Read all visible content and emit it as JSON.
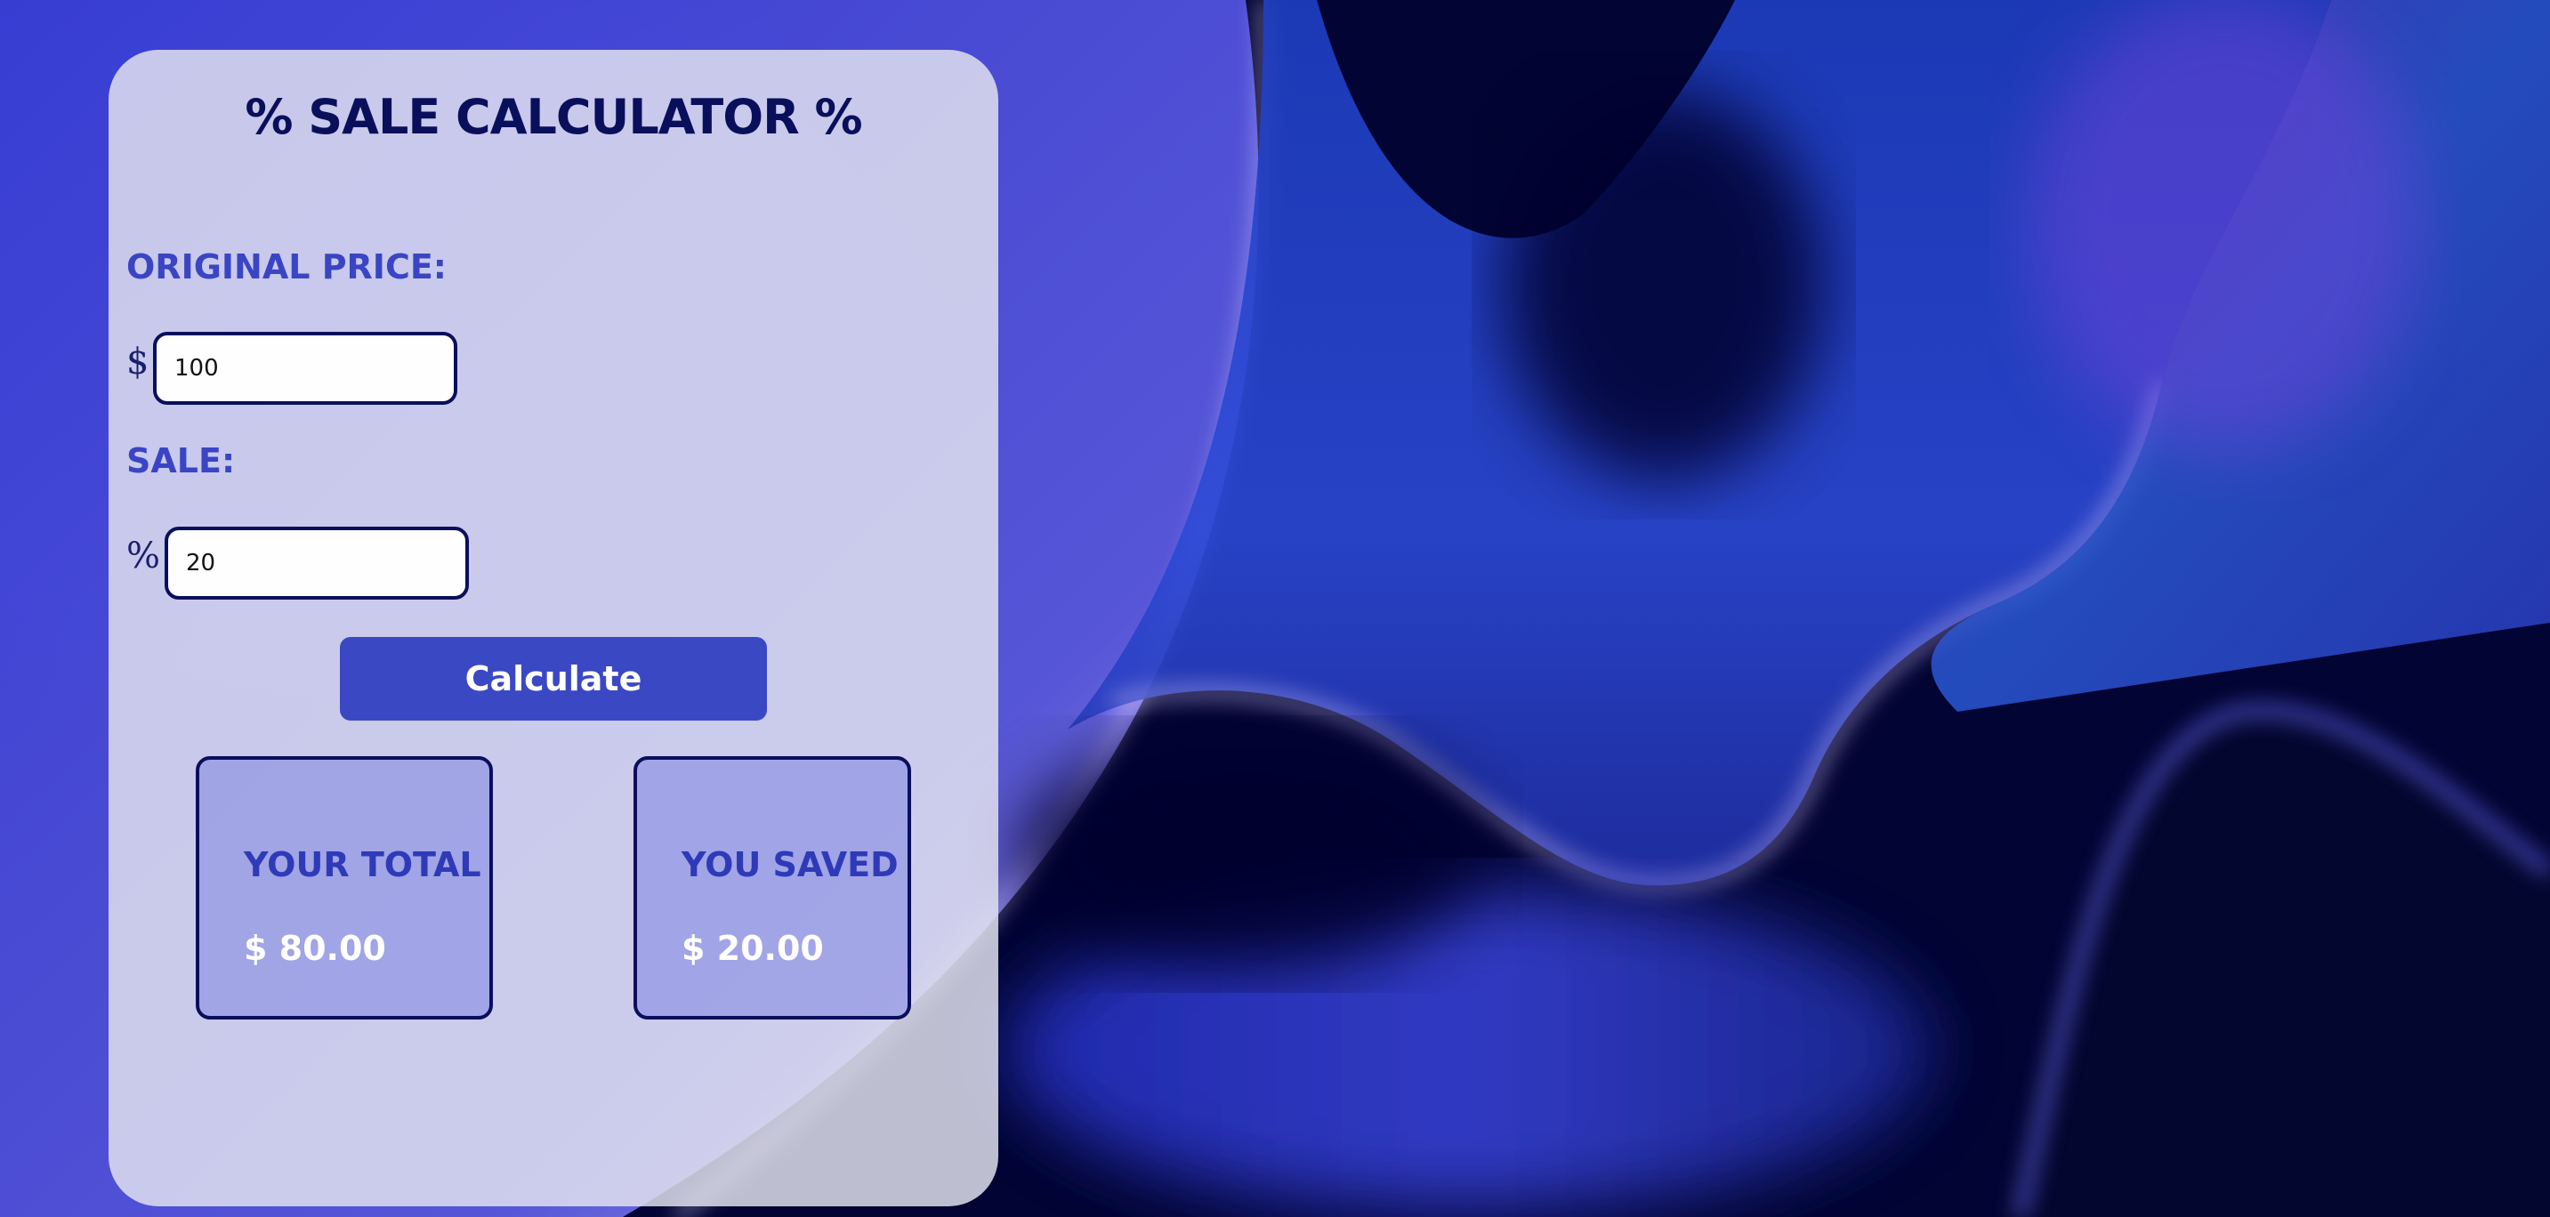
{
  "calculator": {
    "title": "% SALE CALCULATOR %",
    "original_price": {
      "label": "ORIGINAL PRICE:",
      "currency_symbol": "$",
      "value": "100"
    },
    "sale": {
      "label": "SALE:",
      "percent_symbol": "%",
      "value": "20"
    },
    "calculate_label": "Calculate",
    "total": {
      "label": "YOUR TOTAL",
      "value": "$ 80.00"
    },
    "saved": {
      "label": "YOU SAVED",
      "value": "$ 20.00"
    }
  },
  "colors": {
    "background": "#020433",
    "accent": "#3b48c4",
    "title": "#0a0f5c",
    "label": "#3a45c4"
  }
}
